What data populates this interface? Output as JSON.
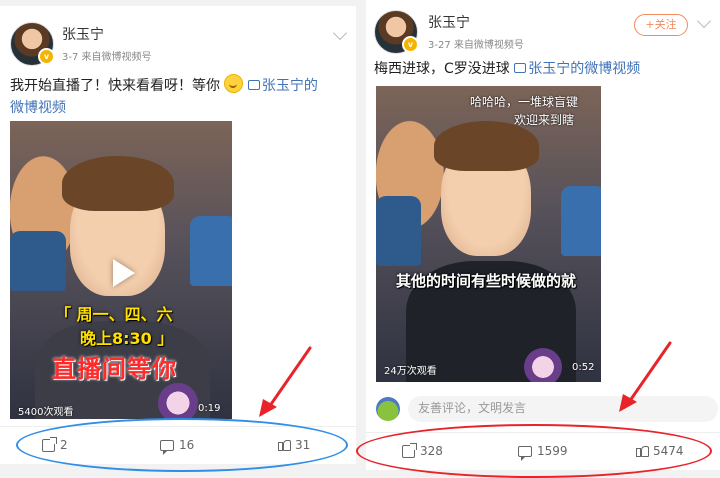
{
  "posts": [
    {
      "username": "张玉宁",
      "date": "3-7",
      "source_prefix": "来自",
      "source": "微博视频号",
      "text_main": "我开始直播了！快来看看呀！等你",
      "video_link": "张玉宁的",
      "video_link_line2": "微博视频",
      "video": {
        "caption_yellow": "「 周一、四、六",
        "caption_yellow_2": "晚上8:30 」",
        "caption_red": "直播间等你",
        "views": "5400次观看",
        "duration": "0:19"
      },
      "actions": {
        "share": "2",
        "comment": "16",
        "like": "31"
      },
      "highlight_color": "#2f8ee8"
    },
    {
      "username": "张玉宁",
      "date": "3-27",
      "source_prefix": "来自",
      "source": "微博视频号",
      "follow_label": "+关注",
      "text_main": "梅西进球，C罗没进球",
      "video_link": "张玉宁的微博视频",
      "video": {
        "overlay_line1": "哈哈哈，一堆球盲键",
        "overlay_line2": "欢迎来到瞎",
        "caption_white": "其他的时间有些时候做的就",
        "views": "24万次观看",
        "duration": "0:52"
      },
      "comment_placeholder": "友善评论，文明发言",
      "actions": {
        "share": "328",
        "comment": "1599",
        "like": "5474"
      },
      "highlight_color": "#e8232a"
    }
  ],
  "annotation_colors": {
    "arrow": "#e8232a",
    "ellipse_left": "#2f8ee8",
    "ellipse_right": "#e8232a"
  }
}
